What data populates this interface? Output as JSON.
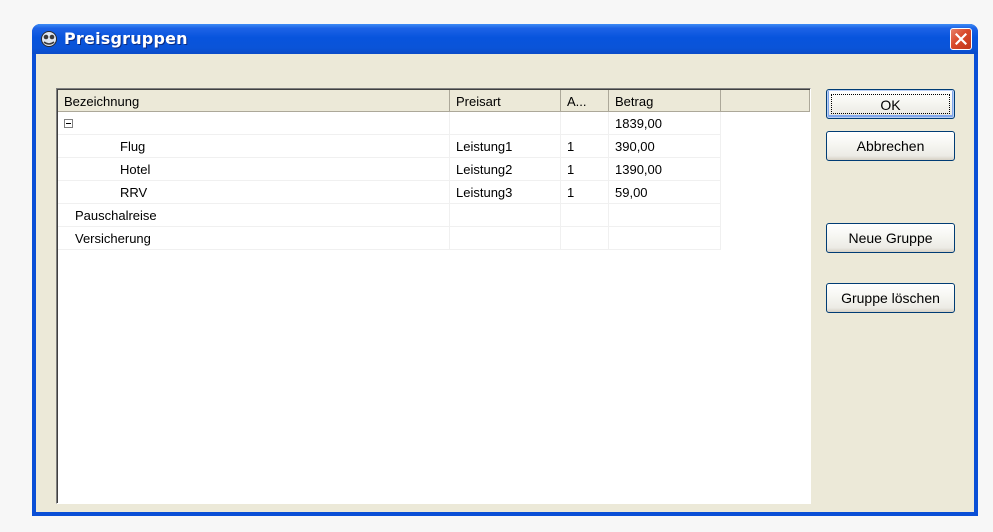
{
  "window": {
    "title": "Preisgruppen"
  },
  "table": {
    "columns": [
      "Bezeichnung",
      "Preisart",
      "A...",
      "Betrag",
      ""
    ],
    "rows": [
      {
        "bezeichnung": "",
        "preisart": "",
        "anzahl": "",
        "betrag": "1839,00",
        "expanded": true
      },
      {
        "bezeichnung": "Flug",
        "preisart": "Leistung1",
        "anzahl": "1",
        "betrag": "390,00"
      },
      {
        "bezeichnung": "Hotel",
        "preisart": "Leistung2",
        "anzahl": "1",
        "betrag": "1390,00"
      },
      {
        "bezeichnung": "RRV",
        "preisart": "Leistung3",
        "anzahl": "1",
        "betrag": "59,00"
      },
      {
        "bezeichnung": "Pauschalreise",
        "preisart": "",
        "anzahl": "",
        "betrag": ""
      },
      {
        "bezeichnung": "Versicherung",
        "preisart": "",
        "anzahl": "",
        "betrag": ""
      }
    ]
  },
  "buttons": {
    "ok": "OK",
    "cancel": "Abbrechen",
    "new_group": "Neue Gruppe",
    "delete_group": "Gruppe löschen"
  },
  "icons": {
    "title_icon": "app-icon",
    "close_icon": "close-icon",
    "expander_icon": "collapse-icon"
  },
  "colors": {
    "titlebar": "#0a54d8",
    "client": "#ece9d8",
    "close_button": "#d9492a"
  }
}
